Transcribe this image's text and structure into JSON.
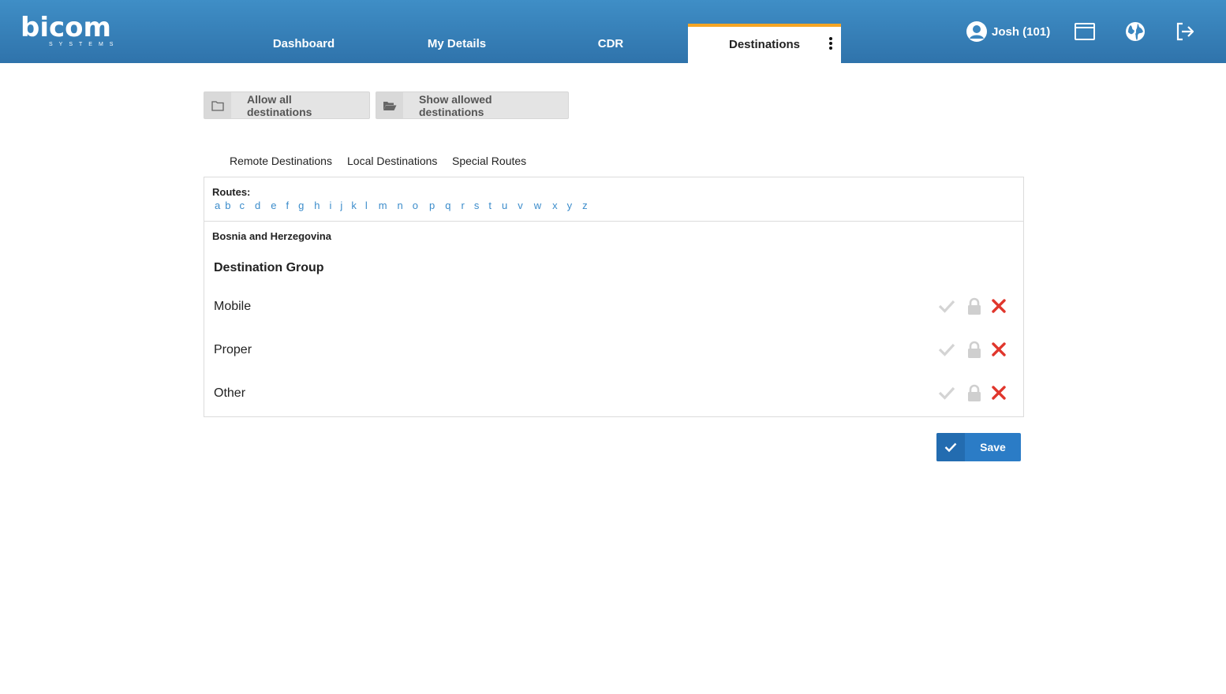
{
  "brand": {
    "name": "bicom",
    "sub": "SYSTEMS"
  },
  "nav": {
    "tabs": [
      {
        "label": "Dashboard"
      },
      {
        "label": "My Details"
      },
      {
        "label": "CDR"
      },
      {
        "label": "Destinations"
      }
    ],
    "active": "Destinations"
  },
  "user": {
    "name": "Josh (101)"
  },
  "toolbar": {
    "allow_all": "Allow all destinations",
    "show_allowed": "Show allowed destinations"
  },
  "subtabs": [
    "Remote Destinations",
    "Local Destinations",
    "Special Routes"
  ],
  "routes": {
    "title": "Routes:",
    "letters": [
      "a",
      "b",
      "c",
      "d",
      "e",
      "f",
      "g",
      "h",
      "i",
      "j",
      "k",
      "l",
      "m",
      "n",
      "o",
      "p",
      "q",
      "r",
      "s",
      "t",
      "u",
      "v",
      "w",
      "x",
      "y",
      "z"
    ]
  },
  "country": "Bosnia and Herzegovina",
  "group_title": "Destination Group",
  "groups": [
    {
      "label": "Mobile"
    },
    {
      "label": "Proper"
    },
    {
      "label": "Other"
    }
  ],
  "colors": {
    "header": "#3a86c0",
    "accent": "#f5a524",
    "link": "#3b8ccb",
    "deny": "#e0362c",
    "primary": "#2b7cc6"
  },
  "save_label": "Save"
}
